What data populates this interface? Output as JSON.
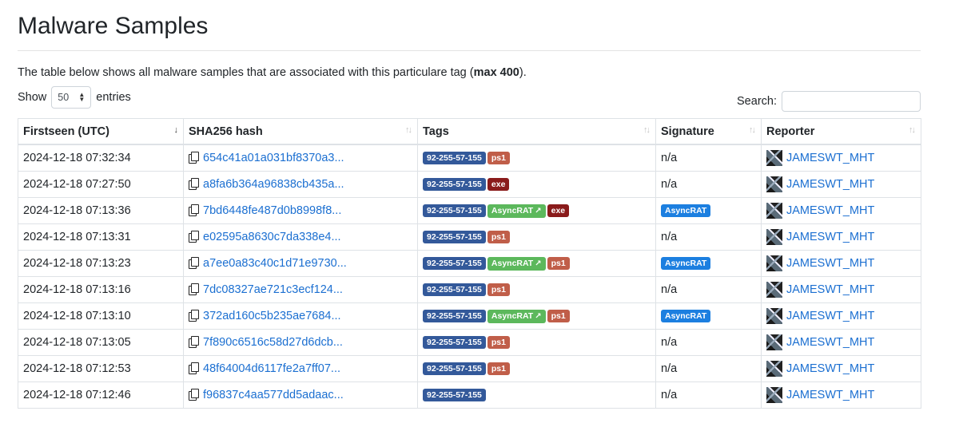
{
  "page": {
    "title": "Malware Samples",
    "intro_text": "The table below shows all malware samples that are associated with this particulare tag (",
    "intro_bold": "max 400",
    "intro_end": ")."
  },
  "controls": {
    "show_label": "Show",
    "entries_value": "50",
    "entries_label": "entries",
    "search_label": "Search:",
    "search_value": ""
  },
  "table": {
    "headers": [
      "Firstseen (UTC)",
      "SHA256 hash",
      "Tags",
      "Signature",
      "Reporter"
    ],
    "rows": [
      {
        "firstseen": "2024-12-18 07:32:34",
        "hash": "654c41a01a031bf8370a3...",
        "tags": [
          {
            "label": "92-255-57-155",
            "kind": "ip"
          },
          {
            "label": "ps1",
            "kind": "ps1"
          }
        ],
        "signature": "n/a",
        "reporter": "JAMESWT_MHT"
      },
      {
        "firstseen": "2024-12-18 07:27:50",
        "hash": "a8fa6b364a96838cb435a...",
        "tags": [
          {
            "label": "92-255-57-155",
            "kind": "ip"
          },
          {
            "label": "exe",
            "kind": "exe"
          }
        ],
        "signature": "n/a",
        "reporter": "JAMESWT_MHT"
      },
      {
        "firstseen": "2024-12-18 07:13:36",
        "hash": "7bd6448fe487d0b8998f8...",
        "tags": [
          {
            "label": "92-255-57-155",
            "kind": "ip"
          },
          {
            "label": "AsyncRAT",
            "kind": "async"
          },
          {
            "label": "exe",
            "kind": "exe"
          }
        ],
        "signature": "AsyncRAT",
        "reporter": "JAMESWT_MHT"
      },
      {
        "firstseen": "2024-12-18 07:13:31",
        "hash": "e02595a8630c7da338e4...",
        "tags": [
          {
            "label": "92-255-57-155",
            "kind": "ip"
          },
          {
            "label": "ps1",
            "kind": "ps1"
          }
        ],
        "signature": "n/a",
        "reporter": "JAMESWT_MHT"
      },
      {
        "firstseen": "2024-12-18 07:13:23",
        "hash": "a7ee0a83c40c1d71e9730...",
        "tags": [
          {
            "label": "92-255-57-155",
            "kind": "ip"
          },
          {
            "label": "AsyncRAT",
            "kind": "async"
          },
          {
            "label": "ps1",
            "kind": "ps1"
          }
        ],
        "signature": "AsyncRAT",
        "reporter": "JAMESWT_MHT"
      },
      {
        "firstseen": "2024-12-18 07:13:16",
        "hash": "7dc08327ae721c3ecf124...",
        "tags": [
          {
            "label": "92-255-57-155",
            "kind": "ip"
          },
          {
            "label": "ps1",
            "kind": "ps1"
          }
        ],
        "signature": "n/a",
        "reporter": "JAMESWT_MHT"
      },
      {
        "firstseen": "2024-12-18 07:13:10",
        "hash": "372ad160c5b235ae7684...",
        "tags": [
          {
            "label": "92-255-57-155",
            "kind": "ip"
          },
          {
            "label": "AsyncRAT",
            "kind": "async"
          },
          {
            "label": "ps1",
            "kind": "ps1"
          }
        ],
        "signature": "AsyncRAT",
        "reporter": "JAMESWT_MHT"
      },
      {
        "firstseen": "2024-12-18 07:13:05",
        "hash": "7f890c6516c58d27d6dcb...",
        "tags": [
          {
            "label": "92-255-57-155",
            "kind": "ip"
          },
          {
            "label": "ps1",
            "kind": "ps1"
          }
        ],
        "signature": "n/a",
        "reporter": "JAMESWT_MHT"
      },
      {
        "firstseen": "2024-12-18 07:12:53",
        "hash": "48f64004d6117fe2a7ff07...",
        "tags": [
          {
            "label": "92-255-57-155",
            "kind": "ip"
          },
          {
            "label": "ps1",
            "kind": "ps1"
          }
        ],
        "signature": "n/a",
        "reporter": "JAMESWT_MHT"
      },
      {
        "firstseen": "2024-12-18 07:12:46",
        "hash": "f96837c4aa577dd5adaac...",
        "tags": [
          {
            "label": "92-255-57-155",
            "kind": "ip"
          }
        ],
        "signature": "n/a",
        "reporter": "JAMESWT_MHT"
      }
    ]
  },
  "colors": {
    "link": "#1b6fd1",
    "tag_ip": "#33599a",
    "tag_ps1": "#c05e49",
    "tag_exe": "#8a1b1b",
    "tag_asyncrat": "#5cb85c",
    "signature_badge": "#1c7fe0"
  },
  "icons": {
    "copy": "copy-icon",
    "external_link": "external-link-icon",
    "sort": "sort-icon",
    "avatar": "reporter-avatar"
  }
}
